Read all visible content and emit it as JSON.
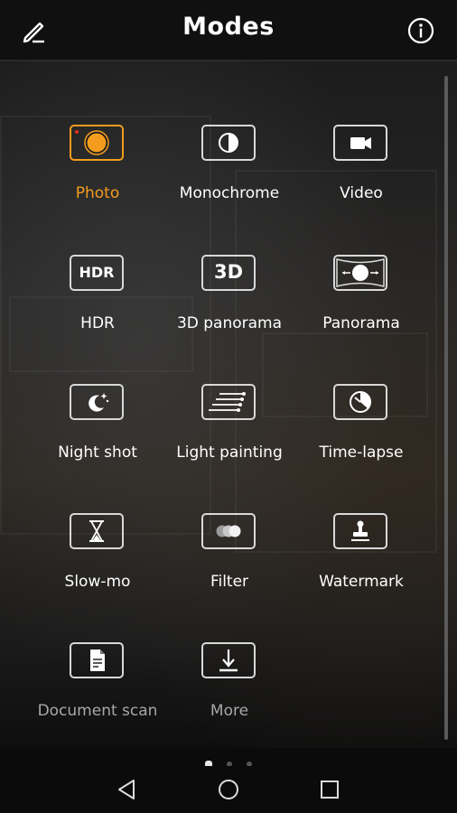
{
  "header": {
    "title": "Modes",
    "edit_icon": "pencil-icon",
    "info_icon": "info-icon"
  },
  "modes": [
    {
      "label": "Photo",
      "icon": "photo-icon",
      "selected": true
    },
    {
      "label": "Monochrome",
      "icon": "monochrome-icon"
    },
    {
      "label": "Video",
      "icon": "video-camera-icon"
    },
    {
      "label": "HDR",
      "icon": "hdr-icon"
    },
    {
      "label": "3D panorama",
      "icon": "3d-panorama-icon"
    },
    {
      "label": "Panorama",
      "icon": "panorama-icon"
    },
    {
      "label": "Night shot",
      "icon": "night-moon-icon"
    },
    {
      "label": "Light painting",
      "icon": "light-painting-icon"
    },
    {
      "label": "Time-lapse",
      "icon": "time-lapse-icon"
    },
    {
      "label": "Slow-mo",
      "icon": "hourglass-icon"
    },
    {
      "label": "Filter",
      "icon": "filter-circles-icon"
    },
    {
      "label": "Watermark",
      "icon": "stamp-icon"
    },
    {
      "label": "Document scan",
      "icon": "document-icon"
    },
    {
      "label": "More",
      "icon": "download-icon"
    }
  ],
  "tile_text": {
    "hdr": "HDR",
    "three_d": "3D"
  },
  "pager": {
    "pages": 3,
    "current": 1
  },
  "navbar": {
    "back_icon": "back-triangle-icon",
    "home_icon": "home-circle-icon",
    "recents_icon": "recents-square-icon"
  },
  "colors": {
    "accent": "#f39c1e",
    "record_dot": "#e0301e",
    "tile_border": "#d9d9d9"
  }
}
